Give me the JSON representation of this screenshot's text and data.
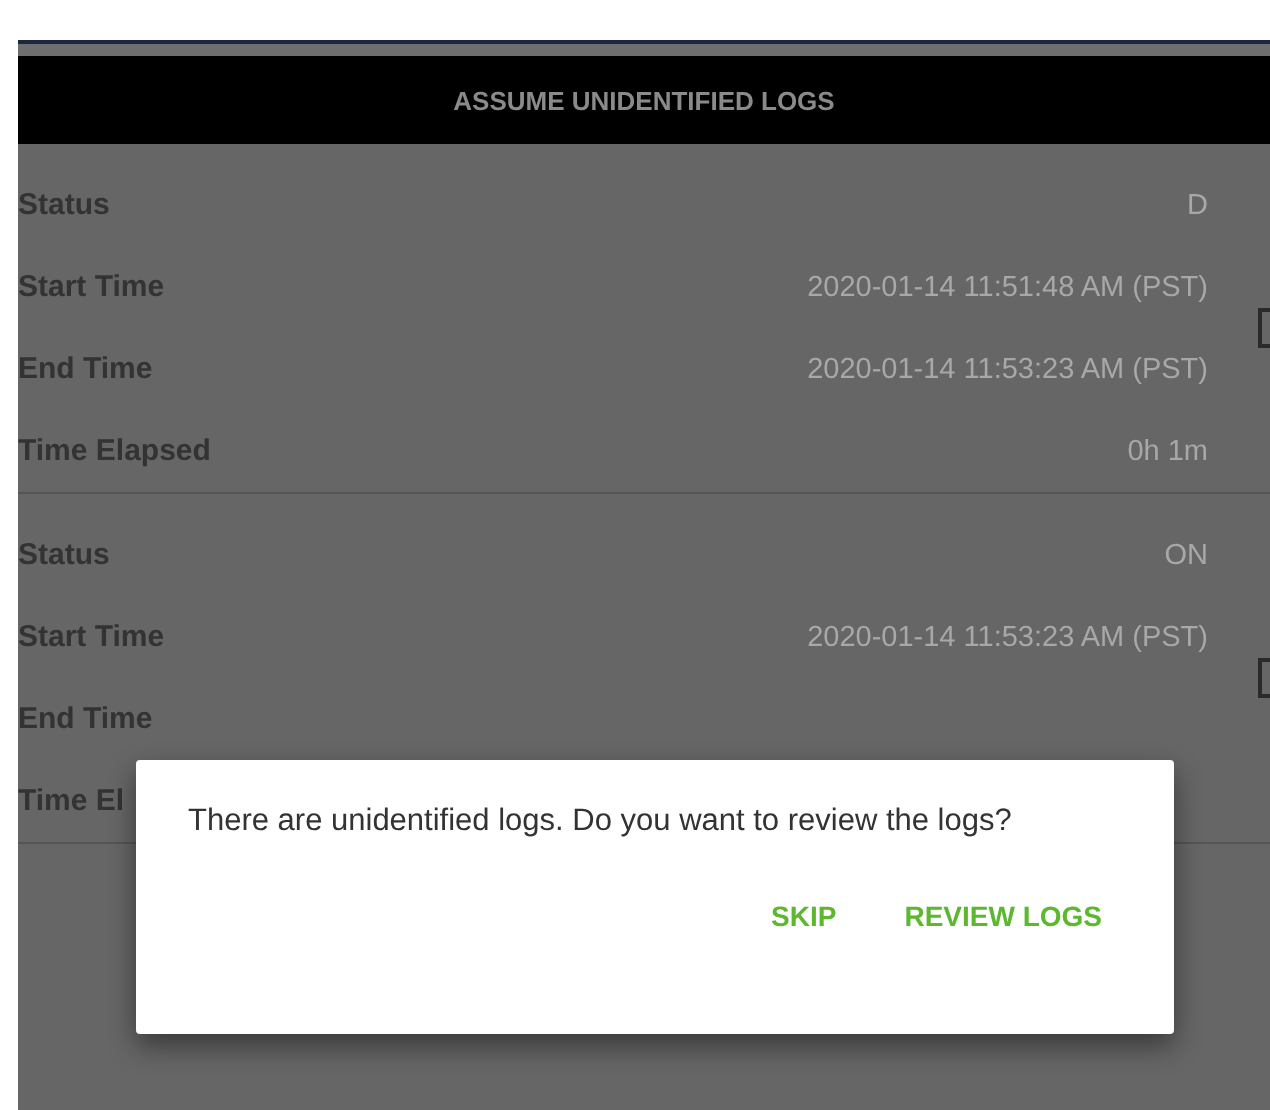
{
  "header": {
    "title": "ASSUME UNIDENTIFIED LOGS"
  },
  "log_groups": [
    {
      "checked": false,
      "rows": [
        {
          "label": "Status",
          "value": "D"
        },
        {
          "label": "Start Time",
          "value": "2020-01-14 11:51:48 AM (PST)"
        },
        {
          "label": "End Time",
          "value": "2020-01-14 11:53:23 AM (PST)"
        },
        {
          "label": "Time Elapsed",
          "value": "0h 1m"
        }
      ]
    },
    {
      "checked": false,
      "rows": [
        {
          "label": "Status",
          "value": "ON"
        },
        {
          "label": "Start Time",
          "value": "2020-01-14 11:53:23 AM (PST)"
        },
        {
          "label": "End Time"
        },
        {
          "label": "Time El"
        }
      ]
    }
  ],
  "dialog": {
    "message": "There are unidentified logs. Do you want to review the logs?",
    "buttons": [
      "SKIP",
      "REVIEW LOGS"
    ]
  }
}
